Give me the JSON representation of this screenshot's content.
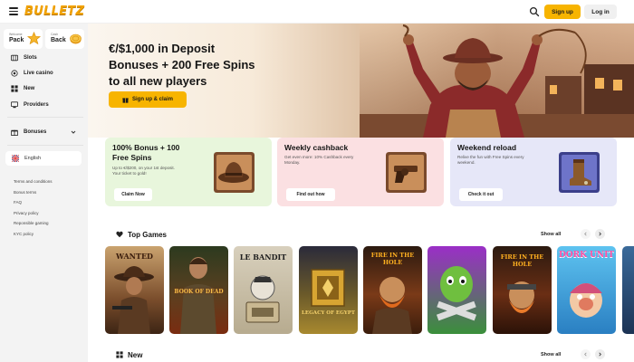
{
  "brand": {
    "logo_text": "BULLETZ",
    "accent": "#f7b400"
  },
  "header": {
    "signup_label": "Sign up",
    "login_label": "Log in"
  },
  "sidebar": {
    "promos": [
      {
        "small": "Welcome",
        "big": "Pack",
        "icon": "star-icon"
      },
      {
        "small": "Cash",
        "big": "Back",
        "icon": "coin-icon"
      }
    ],
    "nav": [
      {
        "label": "Slots",
        "icon": "slot-icon"
      },
      {
        "label": "Live casino",
        "icon": "live-icon"
      },
      {
        "label": "New",
        "icon": "grid-icon"
      },
      {
        "label": "Providers",
        "icon": "providers-icon"
      }
    ],
    "bonuses_label": "Bonuses",
    "language": "English",
    "footer_links": [
      "Terms and conditions",
      "Bonus terms",
      "FAQ",
      "Privacy policy",
      "Reponsible gaming",
      "KYC policy"
    ]
  },
  "hero": {
    "title_lines": [
      "€/$1,000 in Deposit",
      "Bonuses + 200 Free Spins",
      "to all new players"
    ],
    "cta_label": "Sign up & claim"
  },
  "offers": [
    {
      "title_lines": [
        "100% Bonus + 100",
        "Free Spins"
      ],
      "desc_lines": [
        "Up to €/$200, on your 1st deposit.",
        "Your ticket to gold!"
      ],
      "button": "Claim Now",
      "bg": "#e8f6dc"
    },
    {
      "title_lines": [
        "Weekly cashback"
      ],
      "desc_lines": [
        "Get even more: 10% Cashback every",
        "Monday."
      ],
      "button": "Find out how",
      "bg": "#fbe0e2"
    },
    {
      "title_lines": [
        "Weekend reload"
      ],
      "desc_lines": [
        "Relive the fun with Free Spins every",
        "weekend."
      ],
      "button": "Check it out",
      "bg": "#e6e7f8"
    }
  ],
  "top_games": {
    "title": "Top Games",
    "show_all": "Show all",
    "games": [
      {
        "label": "WANTED"
      },
      {
        "label": "BOOK OF DEAD"
      },
      {
        "label": "LE BANDIT"
      },
      {
        "label": "LEGACY OF EGYPT"
      },
      {
        "label": "FIRE IN THE HOLE"
      },
      {
        "label": ""
      },
      {
        "label": "FIRE IN THE HOLE"
      },
      {
        "label": "DORK UNIT"
      },
      {
        "label": ""
      }
    ]
  },
  "new_section": {
    "title": "New",
    "show_all": "Show all"
  }
}
